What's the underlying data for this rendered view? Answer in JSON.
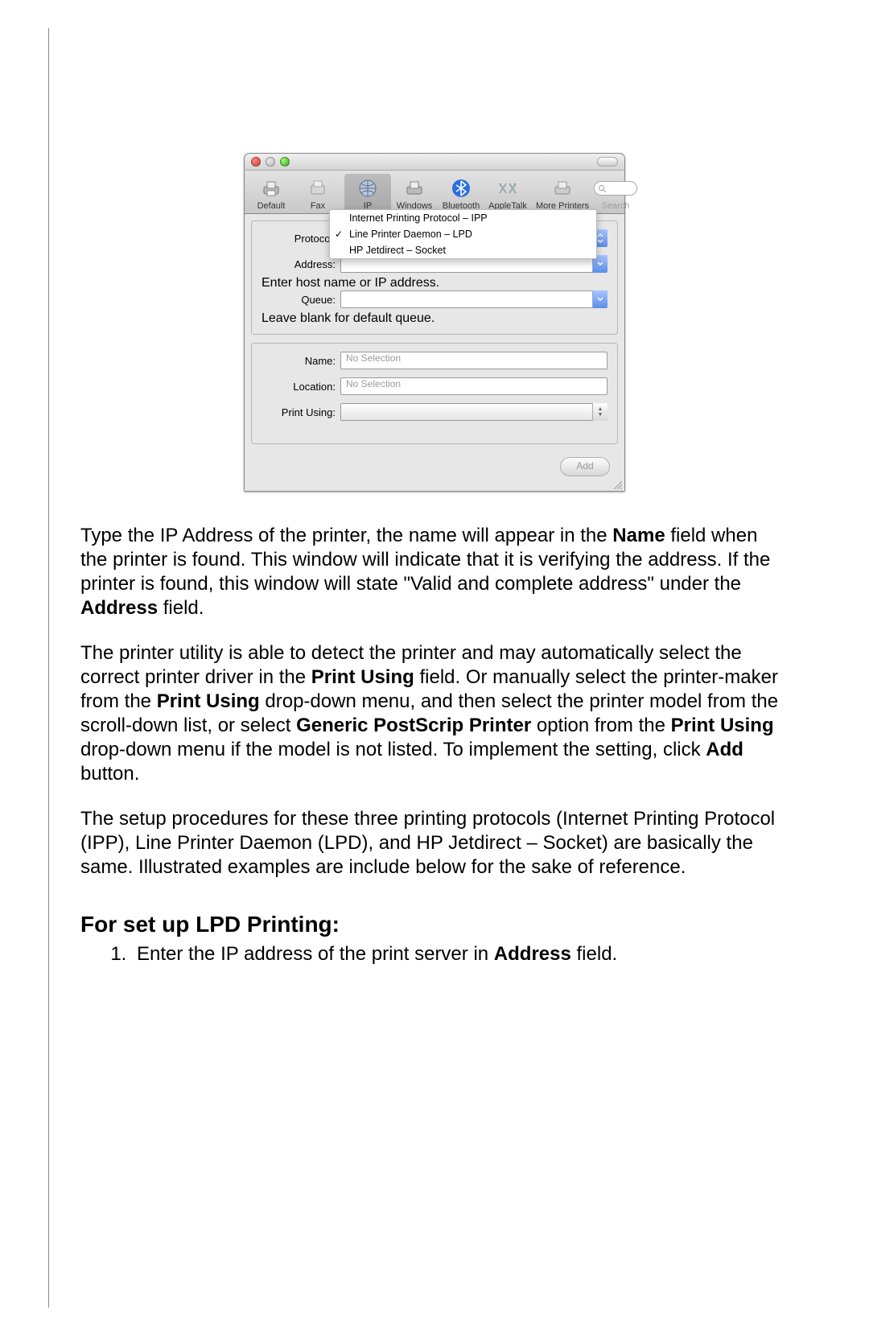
{
  "toolbar": {
    "items": [
      {
        "label": "Default"
      },
      {
        "label": "Fax"
      },
      {
        "label": "IP"
      },
      {
        "label": "Windows"
      },
      {
        "label": "Bluetooth"
      },
      {
        "label": "AppleTalk"
      },
      {
        "label": "More Printers"
      }
    ],
    "search_label": "Search"
  },
  "protocol_menu": {
    "options": [
      "Internet Printing Protocol – IPP",
      "Line Printer Daemon – LPD",
      "HP Jetdirect – Socket"
    ],
    "selected_index": 1
  },
  "labels": {
    "protocol": "Protocol:",
    "address": "Address:",
    "address_hint": "Enter host name or IP address.",
    "queue": "Queue:",
    "queue_hint": "Leave blank for default queue.",
    "name": "Name:",
    "location": "Location:",
    "print_using": "Print Using:"
  },
  "fields": {
    "address_value": "",
    "queue_value": "",
    "name_placeholder": "No Selection",
    "location_placeholder": "No Selection",
    "print_using_value": ""
  },
  "buttons": {
    "add": "Add"
  },
  "doc": {
    "p1_a": "Type the IP Address of the printer, the name will appear in the ",
    "p1_b_name": "Name",
    "p1_c": " field when the printer is found. This window will indicate that it is verifying the address. If the printer is found, this window will state \"Valid and complete address\" under the ",
    "p1_d_address": "Address",
    "p1_e": " field.",
    "p2_a": "The printer utility is able to detect the printer and may automatically select the correct printer driver in the ",
    "p2_b_pu": "Print Using",
    "p2_c": " field. Or manually select the printer-maker from the ",
    "p2_d_pu": "Print Using",
    "p2_e": " drop-down menu, and then select the printer model from the scroll-down list, or select ",
    "p2_f_gpp": "Generic PostScrip Printer",
    "p2_g": " option from the ",
    "p2_h_pu": "Print Using",
    "p2_i": " drop-down menu if the model is not listed. To implement the setting, click ",
    "p2_j_add": "Add",
    "p2_k": " button.",
    "p3": "The setup procedures for these three printing protocols (Internet Printing Protocol (IPP), Line Printer Daemon (LPD), and HP Jetdirect – Socket) are basically the same. Illustrated examples are include below for the sake of reference.",
    "heading": "For set up LPD Printing:",
    "li1_a": "Enter the IP address of the print server in ",
    "li1_b_address": "Address",
    "li1_c": " field."
  }
}
